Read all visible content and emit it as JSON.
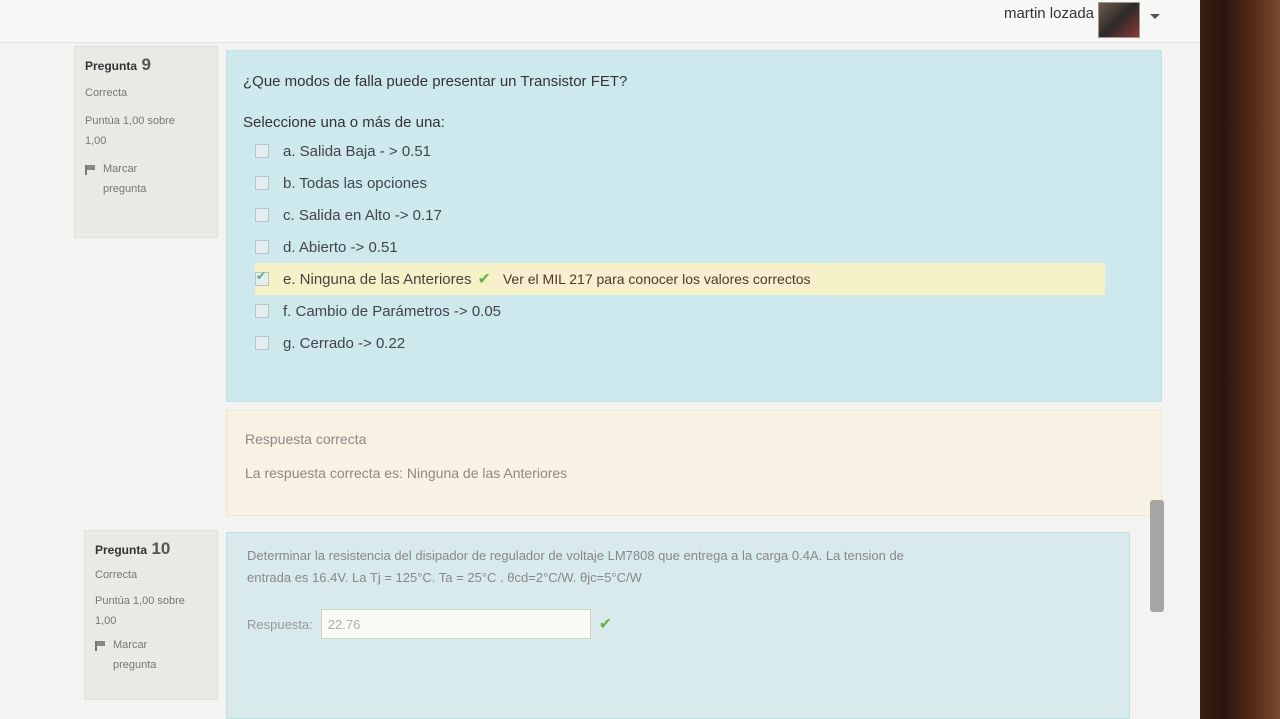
{
  "header": {
    "user_name": "martin lozada"
  },
  "q9": {
    "label": "Pregunta",
    "number": "9",
    "status": "Correcta",
    "score_line1": "Puntúa 1,00 sobre",
    "score_line2": "1,00",
    "flag_line1": "Marcar",
    "flag_line2": "pregunta",
    "question": "¿Que modos de falla puede presentar un Transistor FET?",
    "prompt": "Seleccione una o más de una:",
    "options": [
      {
        "label": "a. Salida Baja - > 0.51",
        "checked": false
      },
      {
        "label": "b. Todas las opciones",
        "checked": false
      },
      {
        "label": "c. Salida en Alto -> 0.17",
        "checked": false
      },
      {
        "label": "d. Abierto -> 0.51",
        "checked": false
      },
      {
        "label": "e. Ninguna de las Anteriores",
        "checked": true
      },
      {
        "label": "f. Cambio de Parámetros -> 0.05",
        "checked": false
      },
      {
        "label": "g. Cerrado -> 0.22",
        "checked": false
      }
    ],
    "inline_feedback": "Ver el MIL 217 para conocer los valores correctos",
    "outcome_title": "Respuesta correcta",
    "outcome_text": "La respuesta correcta es: Ninguna de las Anteriores"
  },
  "q10": {
    "label": "Pregunta",
    "number": "10",
    "status": "Correcta",
    "score_line1": "Puntúa 1,00 sobre",
    "score_line2": "1,00",
    "flag_line1": "Marcar",
    "flag_line2": "pregunta",
    "question_line1": "Determinar la resistencia del disipador de regulador de voltaje LM7808 que entrega a la carga 0.4A. La tension de",
    "question_line2": "entrada es 16.4V. La Tj = 125°C. Ta = 25°C . θcd=2°C/W. θjc=5°C/W",
    "answer_label": "Respuesta:",
    "answer_value": "22.76"
  },
  "colors": {
    "question_bg": "#cde9ee",
    "correct_highlight": "#f6f2c8",
    "outcome_bg": "#f8f2e4",
    "tick": "#6ab04c"
  }
}
